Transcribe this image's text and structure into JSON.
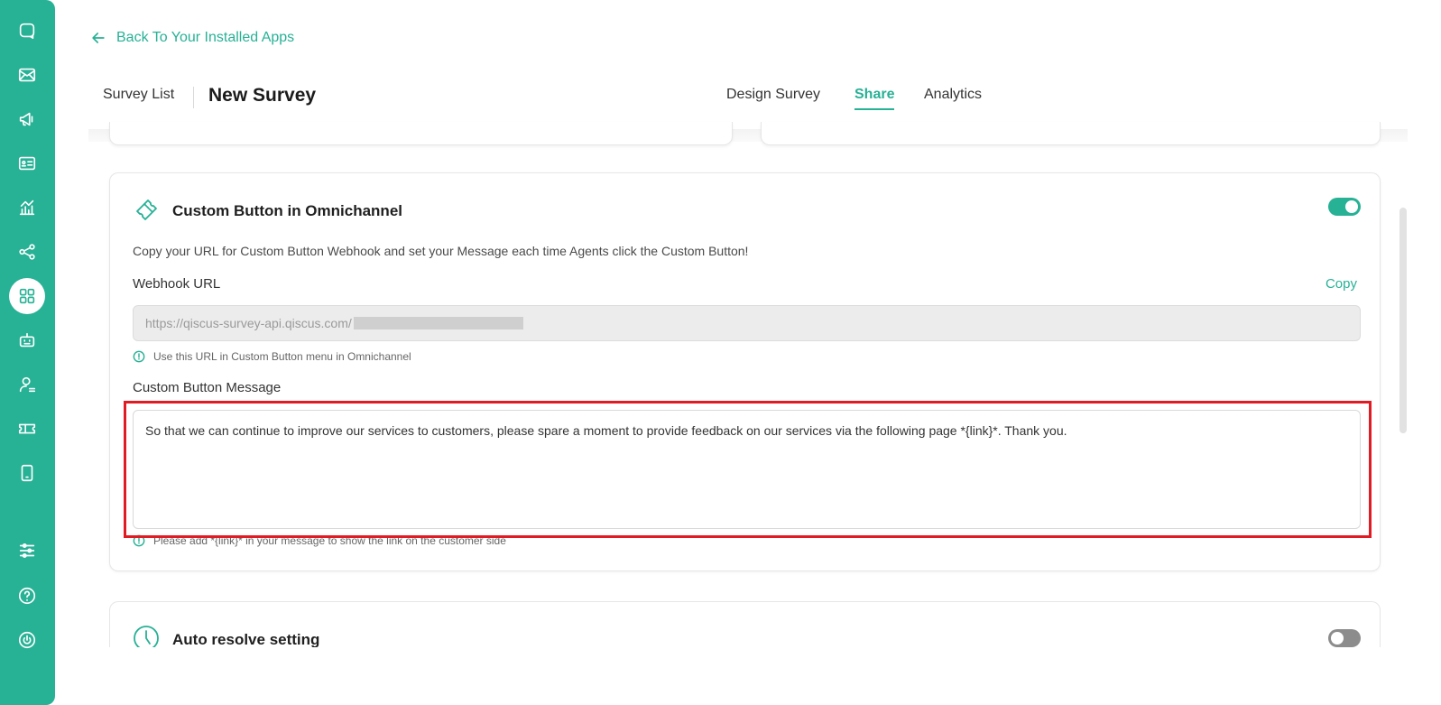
{
  "sidebar": {
    "items": [
      {
        "name": "chat-icon",
        "active": false
      },
      {
        "name": "mail-icon",
        "active": false
      },
      {
        "name": "megaphone-icon",
        "active": false
      },
      {
        "name": "contact-card-icon",
        "active": false
      },
      {
        "name": "analytics-chart-icon",
        "active": false
      },
      {
        "name": "share-nodes-icon",
        "active": false
      },
      {
        "name": "apps-grid-icon",
        "active": true
      },
      {
        "name": "robot-icon",
        "active": false
      },
      {
        "name": "agent-icon",
        "active": false
      },
      {
        "name": "ticket-icon",
        "active": false
      },
      {
        "name": "mobile-icon",
        "active": false
      },
      {
        "name": "settings-sliders-icon",
        "active": false
      },
      {
        "name": "help-icon",
        "active": false
      },
      {
        "name": "power-icon",
        "active": false
      }
    ]
  },
  "header": {
    "back_label": "Back To Your Installed Apps",
    "breadcrumb_list": "Survey List",
    "title": "New Survey",
    "tabs": [
      {
        "label": "Design Survey",
        "active": false
      },
      {
        "label": "Share",
        "active": true
      },
      {
        "label": "Analytics",
        "active": false
      }
    ]
  },
  "custom_button": {
    "title": "Custom Button in Omnichannel",
    "enabled": true,
    "description": "Copy your URL for Custom Button Webhook and set your Message each time Agents click the Custom Button!",
    "webhook_label": "Webhook URL",
    "copy_label": "Copy",
    "webhook_url": "https://qiscus-survey-api.qiscus.com/",
    "webhook_hint": "Use this URL in Custom Button menu in Omnichannel",
    "message_label": "Custom Button Message",
    "message_value": "So that we can continue to improve our services to customers, please spare a moment to provide feedback on our services via the following page *{link}*. Thank you.",
    "message_hint": "Please add *{link}* in your message to show the link on the customer side"
  },
  "auto_resolve": {
    "title": "Auto resolve setting",
    "enabled": false
  },
  "colors": {
    "brand": "#27b195",
    "highlight": "#e01b24"
  }
}
